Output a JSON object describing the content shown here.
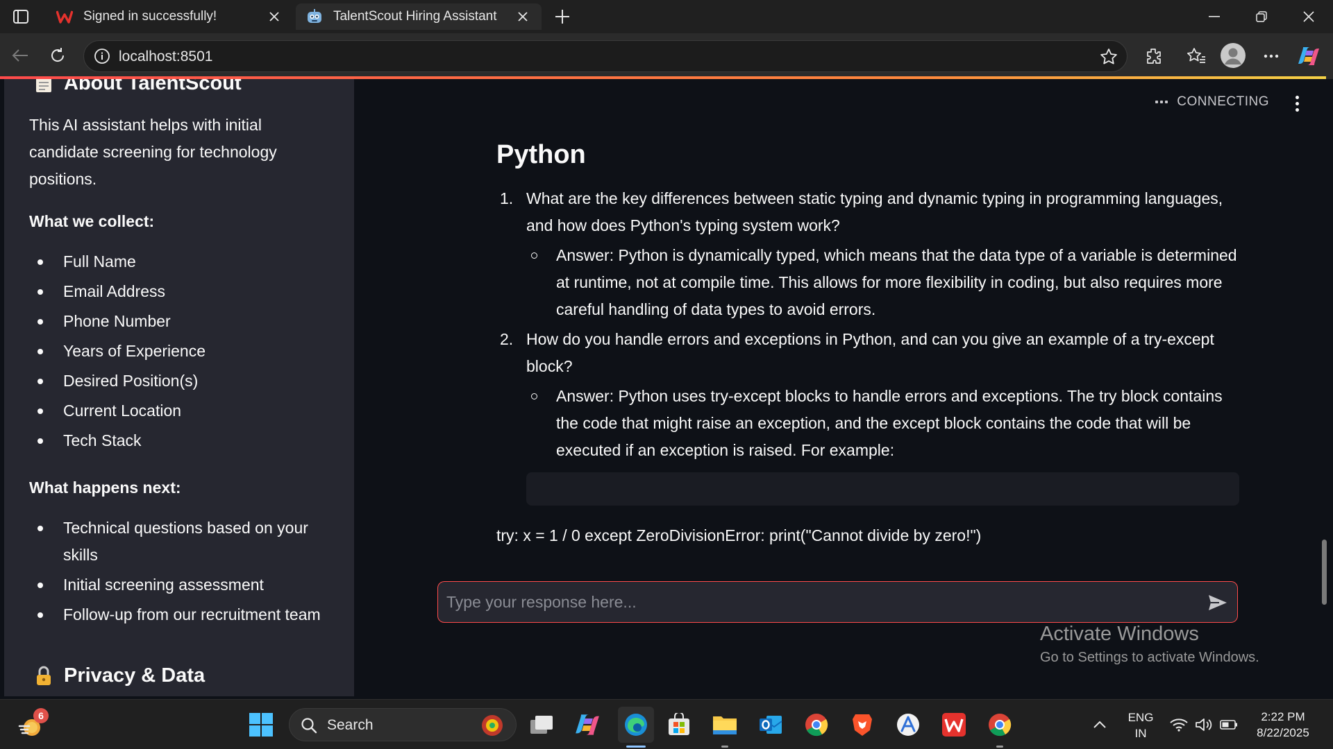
{
  "browser": {
    "tabs": [
      {
        "title": "Signed in successfully!",
        "favicon": "wps-icon",
        "active": false
      },
      {
        "title": "TalentScout Hiring Assistant",
        "favicon": "robot-icon",
        "active": true
      }
    ],
    "url": "localhost:8501"
  },
  "sidebar": {
    "about_heading": "About TalentScout",
    "about_text": "This AI assistant helps with initial candidate screening for technology positions.",
    "collect_heading": "What we collect:",
    "collect_items": [
      "Full Name",
      "Email Address",
      "Phone Number",
      "Years of Experience",
      "Desired Position(s)",
      "Current Location",
      "Tech Stack"
    ],
    "next_heading": "What happens next:",
    "next_items": [
      "Technical questions based on your skills",
      "Initial screening assessment",
      "Follow-up from our recruitment team"
    ],
    "privacy_heading": "Privacy & Data"
  },
  "main": {
    "status": "CONNECTING",
    "section_title": "Python",
    "questions": [
      {
        "number": "1.",
        "question": "What are the key differences between static typing and dynamic typing in programming languages, and how does Python's typing system work?",
        "answer": "Answer: Python is dynamically typed, which means that the data type of a variable is determined at runtime, not at compile time. This allows for more flexibility in coding, but also requires more careful handling of data types to avoid errors."
      },
      {
        "number": "2.",
        "question": "How do you handle errors and exceptions in Python, and can you give an example of a try-except block?",
        "answer": "Answer: Python uses try-except blocks to handle errors and exceptions. The try block contains the code that might raise an exception, and the except block contains the code that will be executed if an exception is raised. For example:"
      }
    ],
    "code_text": "try: x = 1 / 0 except ZeroDivisionError: print(\"Cannot divide by zero!\")",
    "chat_placeholder": "Type your response here..."
  },
  "watermark": {
    "title": "Activate Windows",
    "subtitle": "Go to Settings to activate Windows."
  },
  "taskbar": {
    "search_label": "Search",
    "widget_badge": "6",
    "lang_top": "ENG",
    "lang_bottom": "IN",
    "time": "2:22 PM",
    "date": "8/22/2025"
  },
  "colors": {
    "accent": "#ff4b4b",
    "sidebar_bg": "#262730",
    "main_bg": "#0e1117"
  }
}
